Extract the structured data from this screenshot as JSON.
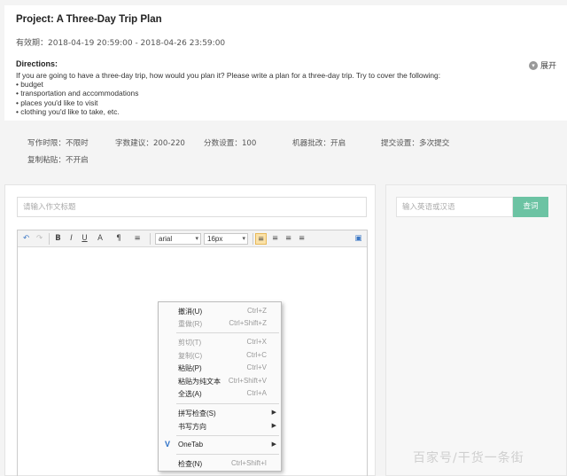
{
  "project": {
    "title": "Project: A Three-Day Trip Plan",
    "validity": "有效期：2018-04-19 20:59:00 - 2018-04-26 23:59:00",
    "directions_heading": "Directions:",
    "directions": [
      "If you are going to have a three-day trip, how would you plan it? Please write a plan for a three-day trip. Try to cover the following:",
      "• budget",
      "• transportation and accommodations",
      "• places you'd like to visit",
      "• clothing you'd like to take, etc."
    ],
    "expand_label": "展开"
  },
  "settings": {
    "time_limit": "写作时限：不限时",
    "word_count": "字数建议：200-220",
    "score": "分数设置：100",
    "machine": "机器批改：开启",
    "submit": "提交设置：多次提交",
    "paste": "复制粘贴：不开启"
  },
  "editor": {
    "title_placeholder": "请输入作文标题",
    "font_family": "arial",
    "font_size": "16px",
    "toolbar": {
      "undo": "↶",
      "redo": "↷",
      "bold": "B",
      "italic": "I",
      "underline": "U",
      "forecolor": "A",
      "paragraph": "¶",
      "lineheight": "≡",
      "align_left": "≡",
      "align_center": "≡",
      "align_right": "≡",
      "justify": "≡",
      "fullscreen": "▣"
    }
  },
  "dictionary": {
    "placeholder": "输入英语或汉语",
    "button": "查词"
  },
  "context_menu": {
    "items": [
      {
        "label": "撤消(U)",
        "shortcut": "Ctrl+Z",
        "disabled": false
      },
      {
        "label": "重做(R)",
        "shortcut": "Ctrl+Shift+Z",
        "disabled": true
      },
      {
        "label": "剪切(T)",
        "shortcut": "Ctrl+X",
        "disabled": true
      },
      {
        "label": "复制(C)",
        "shortcut": "Ctrl+C",
        "disabled": true
      },
      {
        "label": "粘贴(P)",
        "shortcut": "Ctrl+V",
        "disabled": false
      },
      {
        "label": "粘贴为纯文本",
        "shortcut": "Ctrl+Shift+V",
        "disabled": false
      },
      {
        "label": "全选(A)",
        "shortcut": "Ctrl+A",
        "disabled": false
      },
      {
        "label": "拼写检查(S)",
        "shortcut": "",
        "disabled": false
      },
      {
        "label": "书写方向",
        "shortcut": "",
        "disabled": false
      },
      {
        "label": "OneTab",
        "shortcut": "",
        "disabled": false
      },
      {
        "label": "检查(N)",
        "shortcut": "Ctrl+Shift+I",
        "disabled": false
      }
    ],
    "submenu_arrow": "▶"
  },
  "watermark": "百家号/干货一条街",
  "colors": {
    "accent_button": "#6cc3a3",
    "link_blue": "#3a76c4"
  }
}
